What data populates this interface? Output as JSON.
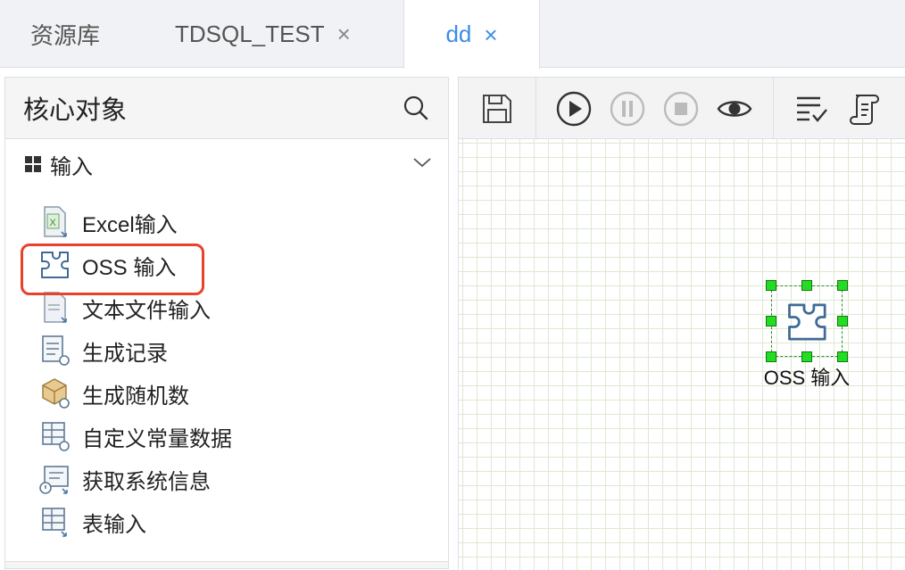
{
  "tabs": [
    {
      "label": "资源库",
      "closable": false,
      "active": false
    },
    {
      "label": "TDSQL_TEST",
      "closable": true,
      "active": false
    },
    {
      "label": "dd",
      "closable": true,
      "active": true
    }
  ],
  "close_glyph": "×",
  "left_panel": {
    "title": "核心对象",
    "search_icon": "search-icon",
    "group": {
      "label": "输入",
      "icon": "grid-icon",
      "chevron": "chevron-down-icon"
    },
    "items": [
      {
        "label": "Excel输入",
        "icon": "excel-file-icon"
      },
      {
        "label": "OSS 输入",
        "icon": "puzzle-icon",
        "highlighted": true
      },
      {
        "label": "文本文件输入",
        "icon": "text-file-icon"
      },
      {
        "label": "生成记录",
        "icon": "generate-records-icon"
      },
      {
        "label": "生成随机数",
        "icon": "random-cube-icon"
      },
      {
        "label": "自定义常量数据",
        "icon": "constant-table-icon"
      },
      {
        "label": "获取系统信息",
        "icon": "system-info-icon"
      },
      {
        "label": "表输入",
        "icon": "table-input-icon"
      }
    ]
  },
  "toolbar": {
    "buttons": [
      "save-icon",
      "run-icon",
      "pause-icon",
      "stop-icon",
      "preview-icon",
      "verify-icon",
      "script-icon"
    ]
  },
  "canvas": {
    "node": {
      "label": "OSS 输入",
      "icon": "puzzle-icon",
      "selected": true
    }
  },
  "colors": {
    "accent": "#3a8ee6",
    "highlight_border": "#e8412c",
    "selection_handle": "#22dd22",
    "grid_line": "#dfe8d2"
  }
}
